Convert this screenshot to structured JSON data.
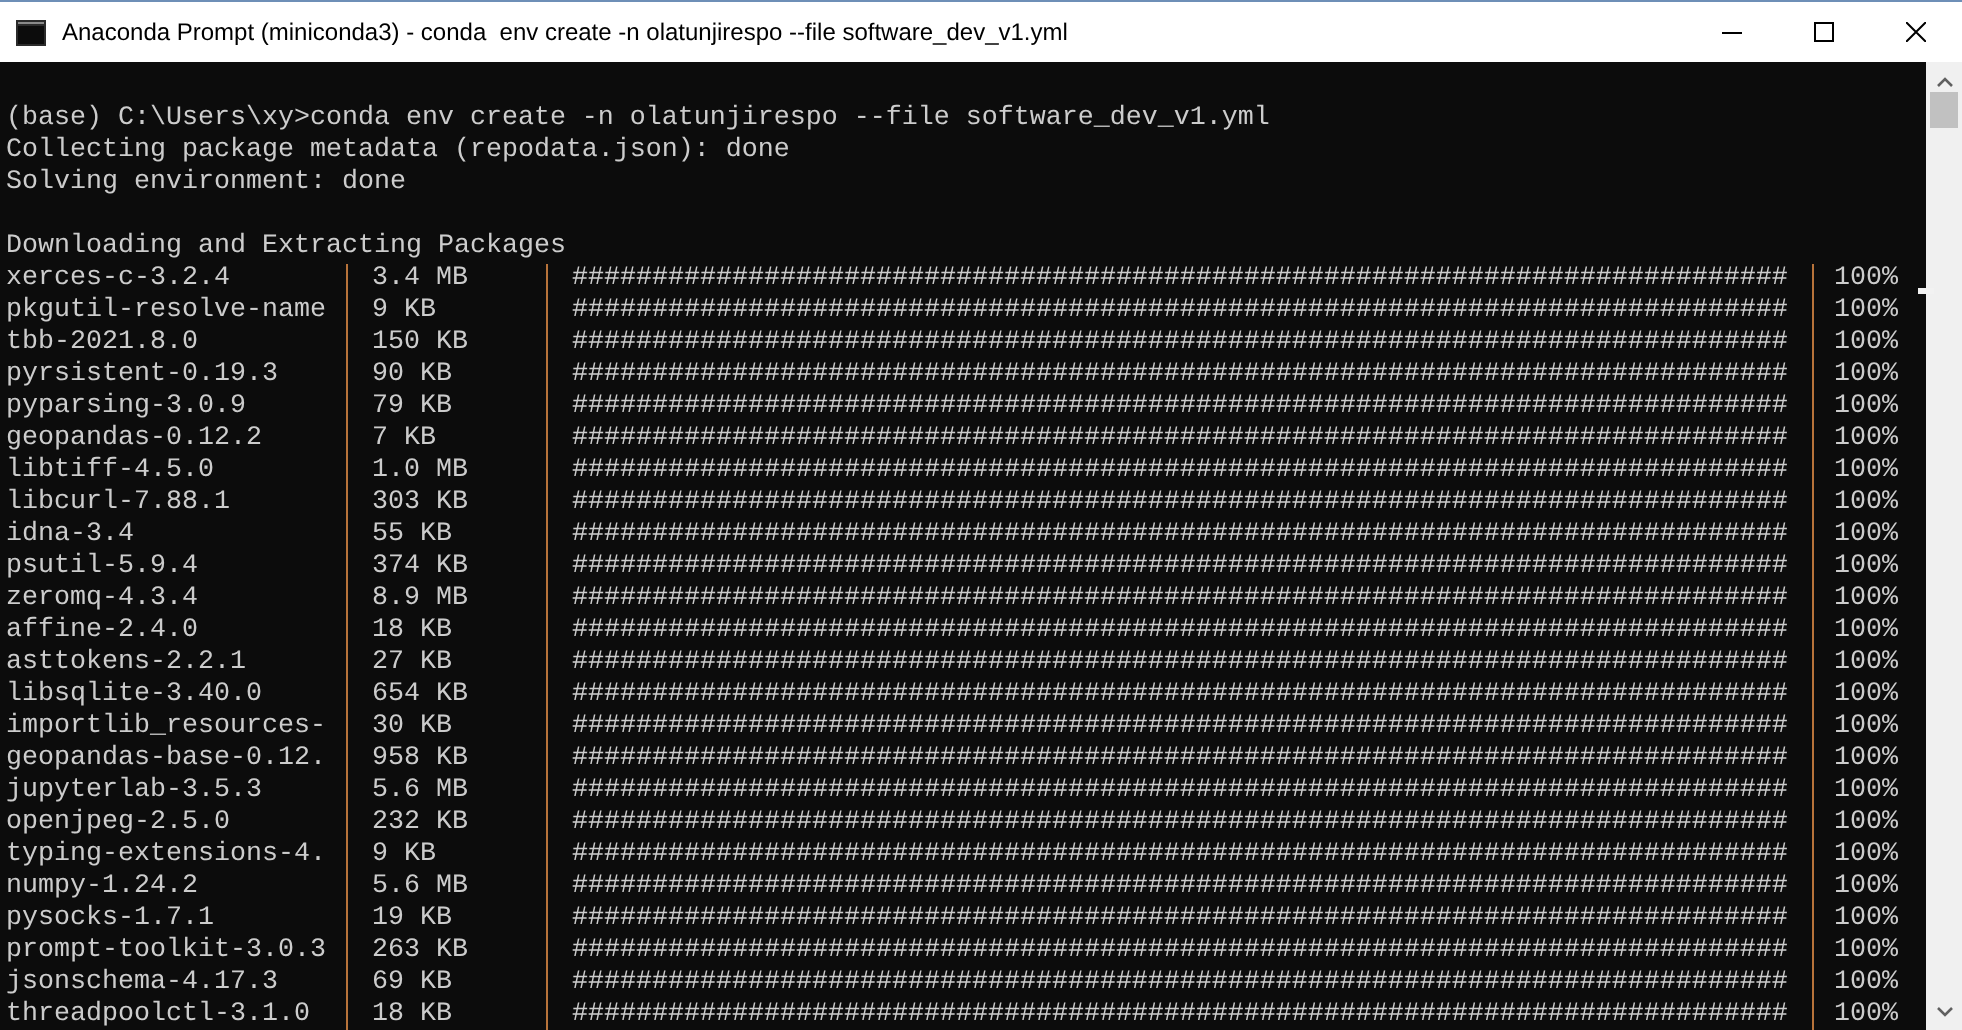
{
  "window": {
    "title": "Anaconda Prompt (miniconda3) - conda  env create -n olatunjirespo --file software_dev_v1.yml"
  },
  "console": {
    "lines": [
      "(base) C:\\Users\\xy>conda env create -n olatunjirespo --file software_dev_v1.yml",
      "Collecting package metadata (repodata.json): done",
      "Solving environment: done"
    ],
    "heading": "Downloading and Extracting Packages",
    "packages": [
      {
        "name": "xerces-c-3.2.4",
        "size": "3.4 MB",
        "bar": "############################################################################",
        "percent": "100%"
      },
      {
        "name": "pkgutil-resolve-name",
        "size": "9 KB",
        "bar": "############################################################################",
        "percent": "100%"
      },
      {
        "name": "tbb-2021.8.0",
        "size": "150 KB",
        "bar": "############################################################################",
        "percent": "100%"
      },
      {
        "name": "pyrsistent-0.19.3",
        "size": "90 KB",
        "bar": "############################################################################",
        "percent": "100%"
      },
      {
        "name": "pyparsing-3.0.9",
        "size": "79 KB",
        "bar": "############################################################################",
        "percent": "100%"
      },
      {
        "name": "geopandas-0.12.2",
        "size": "7 KB",
        "bar": "############################################################################",
        "percent": "100%"
      },
      {
        "name": "libtiff-4.5.0",
        "size": "1.0 MB",
        "bar": "############################################################################",
        "percent": "100%"
      },
      {
        "name": "libcurl-7.88.1",
        "size": "303 KB",
        "bar": "############################################################################",
        "percent": "100%"
      },
      {
        "name": "idna-3.4",
        "size": "55 KB",
        "bar": "############################################################################",
        "percent": "100%"
      },
      {
        "name": "psutil-5.9.4",
        "size": "374 KB",
        "bar": "############################################################################",
        "percent": "100%"
      },
      {
        "name": "zeromq-4.3.4",
        "size": "8.9 MB",
        "bar": "############################################################################",
        "percent": "100%"
      },
      {
        "name": "affine-2.4.0",
        "size": "18 KB",
        "bar": "############################################################################",
        "percent": "100%"
      },
      {
        "name": "asttokens-2.2.1",
        "size": "27 KB",
        "bar": "############################################################################",
        "percent": "100%"
      },
      {
        "name": "libsqlite-3.40.0",
        "size": "654 KB",
        "bar": "############################################################################",
        "percent": "100%"
      },
      {
        "name": "importlib_resources-",
        "size": "30 KB",
        "bar": "############################################################################",
        "percent": "100%"
      },
      {
        "name": "geopandas-base-0.12.",
        "size": "958 KB",
        "bar": "############################################################################",
        "percent": "100%"
      },
      {
        "name": "jupyterlab-3.5.3",
        "size": "5.6 MB",
        "bar": "############################################################################",
        "percent": "100%"
      },
      {
        "name": "openjpeg-2.5.0",
        "size": "232 KB",
        "bar": "############################################################################",
        "percent": "100%"
      },
      {
        "name": "typing-extensions-4.",
        "size": "9 KB",
        "bar": "############################################################################",
        "percent": "100%"
      },
      {
        "name": "numpy-1.24.2",
        "size": "5.6 MB",
        "bar": "############################################################################",
        "percent": "100%"
      },
      {
        "name": "pysocks-1.7.1",
        "size": "19 KB",
        "bar": "############################################################################",
        "percent": "100%"
      },
      {
        "name": "prompt-toolkit-3.0.3",
        "size": "263 KB",
        "bar": "############################################################################",
        "percent": "100%"
      },
      {
        "name": "jsonschema-4.17.3",
        "size": "69 KB",
        "bar": "############################################################################",
        "percent": "100%"
      },
      {
        "name": "threadpoolctl-3.1.0",
        "size": "18 KB",
        "bar": "############################################################################",
        "percent": "100%"
      }
    ]
  }
}
